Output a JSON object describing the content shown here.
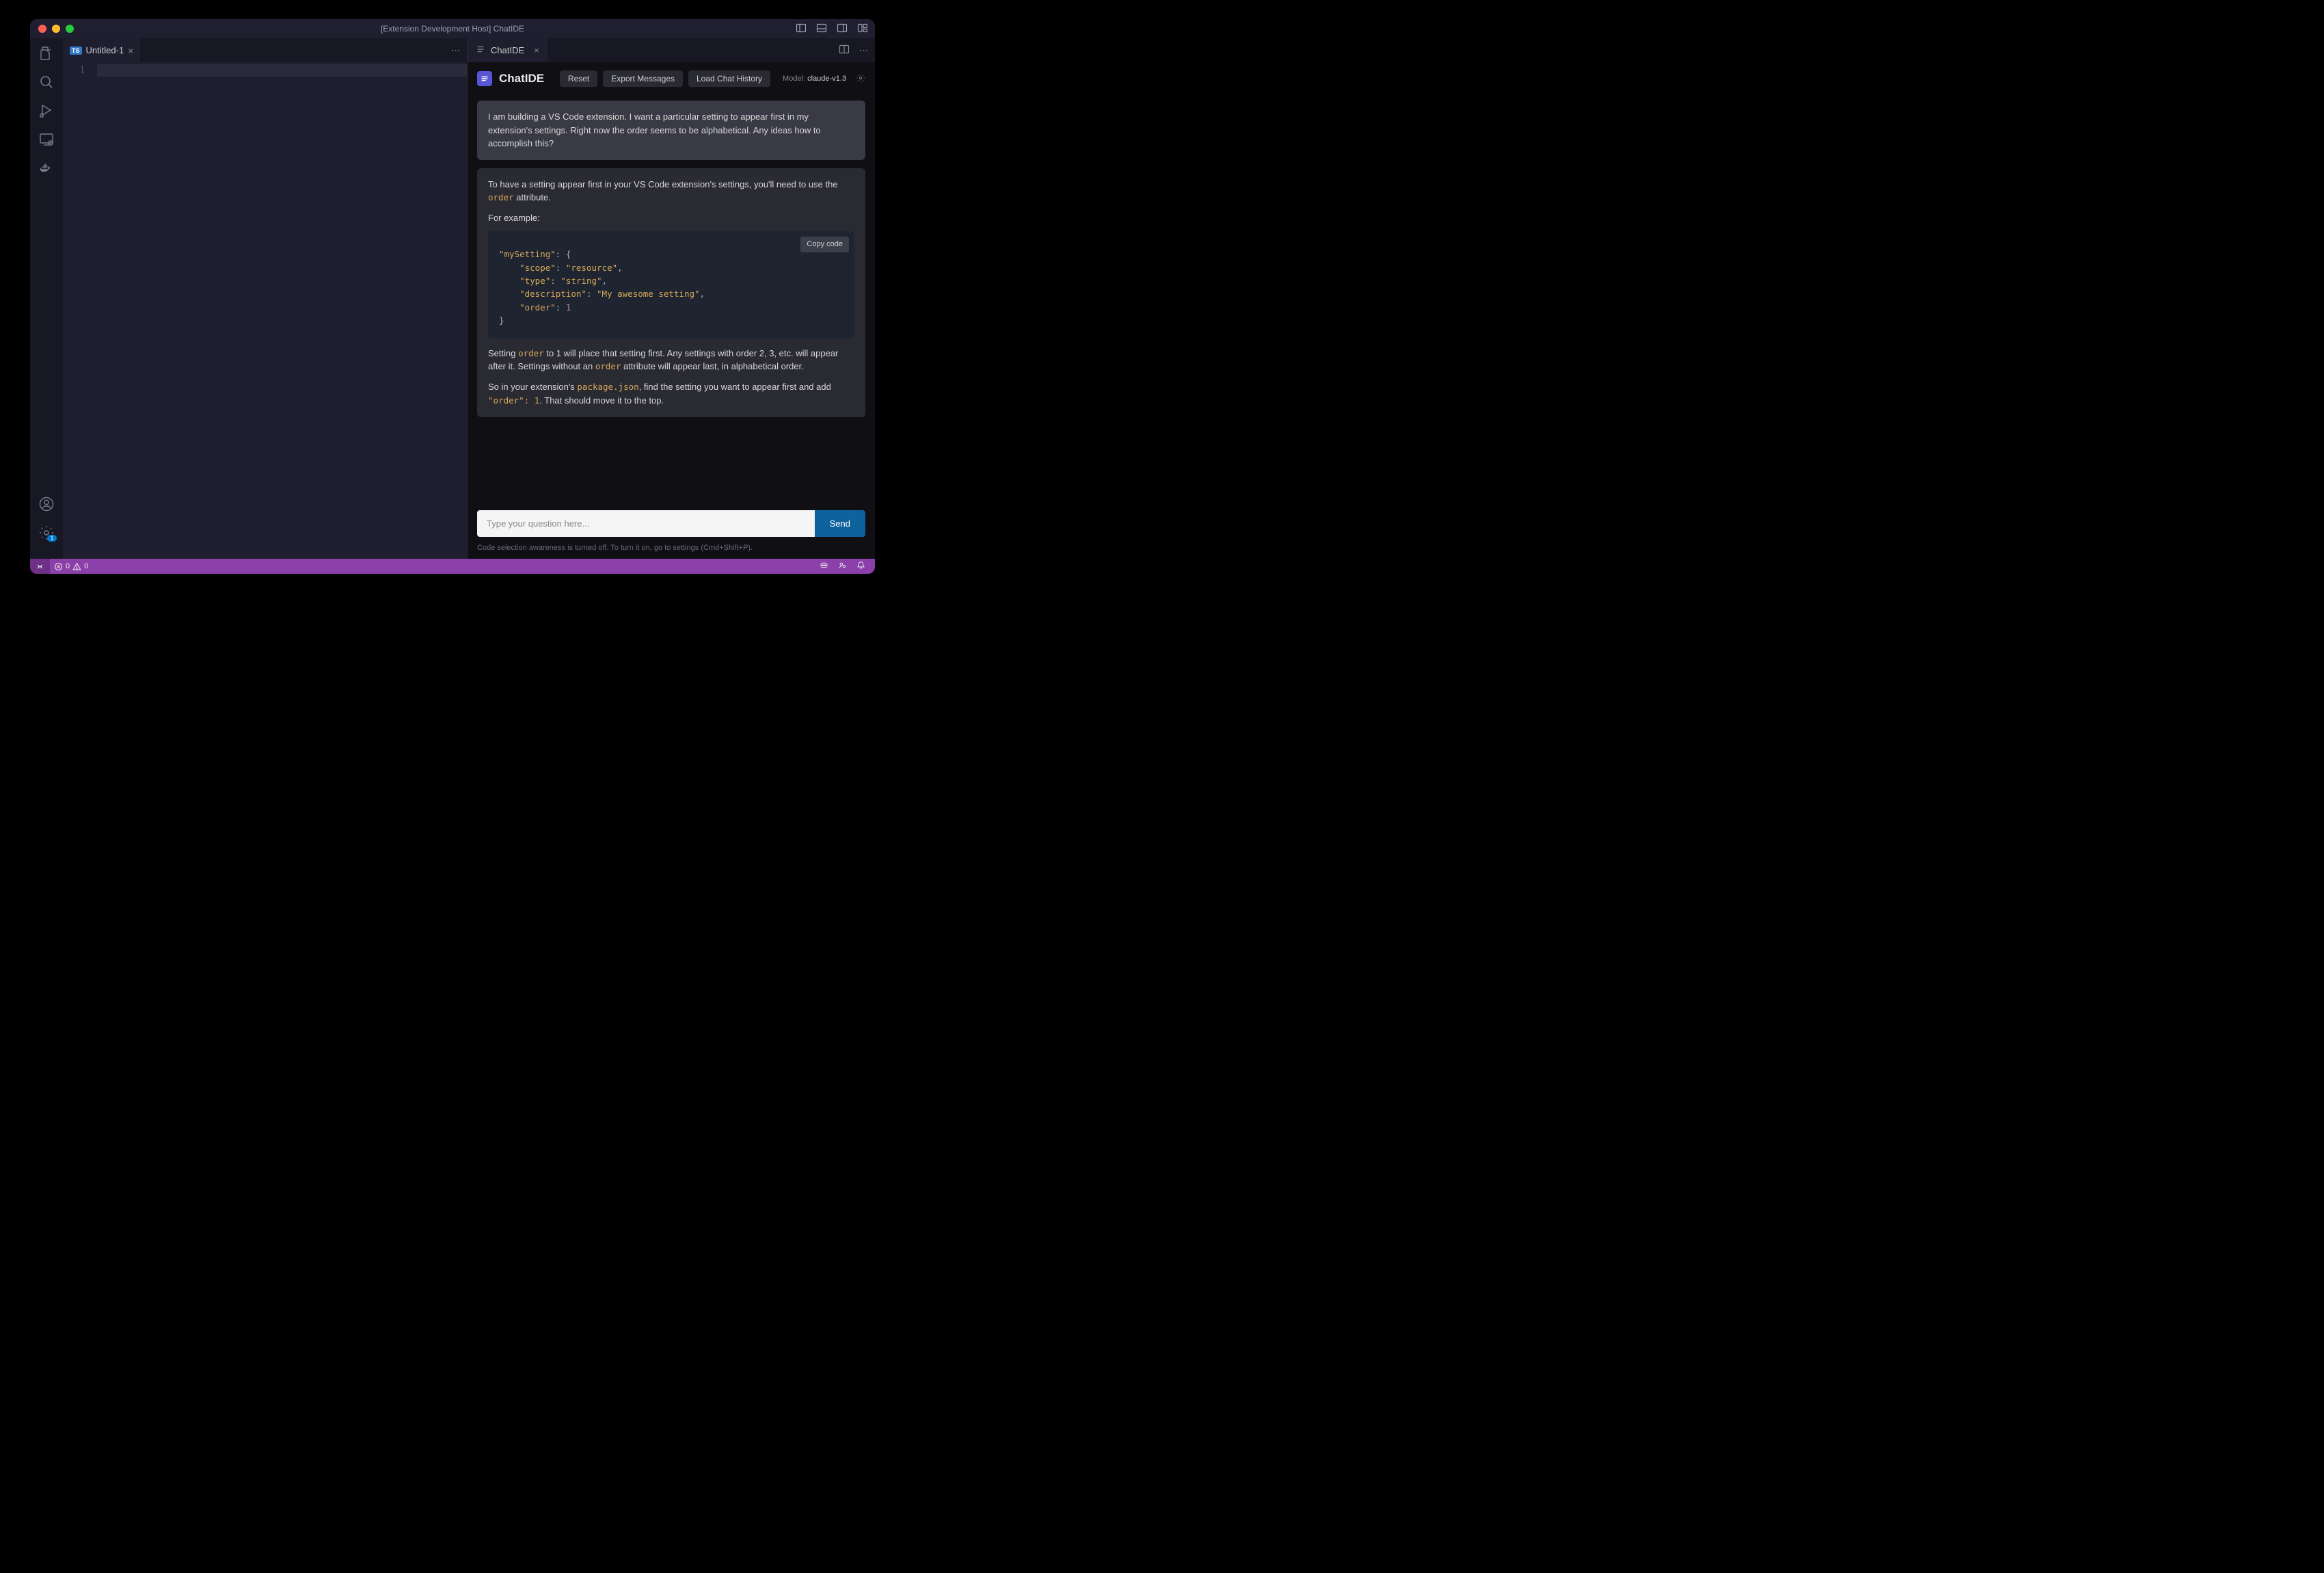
{
  "window": {
    "title": "[Extension Development Host] ChatIDE"
  },
  "editor": {
    "tab": {
      "lang": "TS",
      "name": "Untitled-1"
    },
    "line_number": "1"
  },
  "chatTab": {
    "name": "ChatIDE"
  },
  "chatHeader": {
    "title": "ChatIDE",
    "buttons": {
      "reset": "Reset",
      "export": "Export Messages",
      "load": "Load Chat History"
    },
    "modelLabel": "Model: ",
    "modelName": "claude-v1.3"
  },
  "userMsg": {
    "text": "I am building a VS Code extension. I want a particular setting to appear first in my extension's settings. Right now the order seems to be alphabetical. Any ideas how to accomplish this?"
  },
  "assistantMsg": {
    "p1_a": "To have a setting appear first in your VS Code extension's settings, you'll need to use the ",
    "p1_code": "order",
    "p1_b": " attribute.",
    "p2": "For example:",
    "copy": "Copy code",
    "code": "\"mySetting\": {\n    \"scope\": \"resource\",\n    \"type\": \"string\",\n    \"description\": \"My awesome setting\",\n    \"order\": 1\n}",
    "p3_a": "Setting ",
    "p3_code1": "order",
    "p3_b": " to 1 will place that setting first. Any settings with order 2, 3, etc. will appear after it. Settings without an ",
    "p3_code2": "order",
    "p3_c": " attribute will appear last, in alphabetical order.",
    "p4_a": "So in your extension's ",
    "p4_code1": "package.json",
    "p4_b": ", find the setting you want to appear first and add ",
    "p4_code2": "\"order\": 1",
    "p4_c": ". That should move it to the top."
  },
  "chatInput": {
    "placeholder": "Type your question here...",
    "send": "Send"
  },
  "footerHint": "Code selection awareness is turned off. To turn it on, go to settings (Cmd+Shift+P).",
  "statusbar": {
    "errors": "0",
    "warnings": "0"
  }
}
